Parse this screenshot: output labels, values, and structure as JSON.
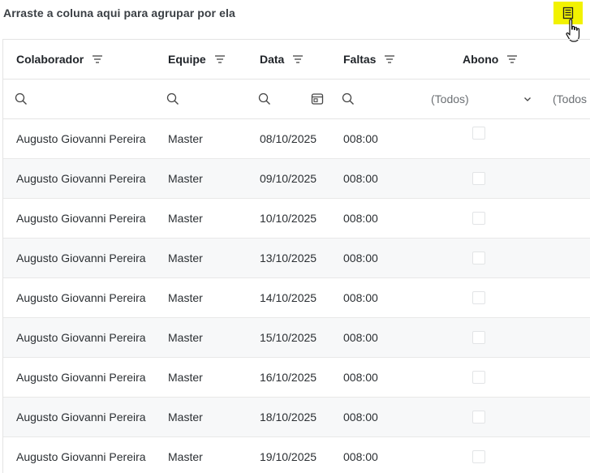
{
  "group_panel": {
    "hint": "Arraste a coluna aqui para agrupar por ela",
    "column_chooser_icon": "column-chooser-icon",
    "highlight_color": "#f2f200"
  },
  "columns": [
    {
      "label": "Colaborador",
      "icon": "filter-lines-icon"
    },
    {
      "label": "Equipe",
      "icon": "filter-lines-icon"
    },
    {
      "label": "Data",
      "icon": "filter-lines-icon"
    },
    {
      "label": "Faltas",
      "icon": "filter-lines-icon"
    },
    {
      "label": "Abono",
      "icon": "filter-lines-icon"
    }
  ],
  "filters": {
    "abono_select": "(Todos)",
    "next_select": "(Todos"
  },
  "rows": [
    {
      "colaborador": "Augusto Giovanni Pereira",
      "equipe": "Master",
      "data": "08/10/2025",
      "faltas": "008:00"
    },
    {
      "colaborador": "Augusto Giovanni Pereira",
      "equipe": "Master",
      "data": "09/10/2025",
      "faltas": "008:00"
    },
    {
      "colaborador": "Augusto Giovanni Pereira",
      "equipe": "Master",
      "data": "10/10/2025",
      "faltas": "008:00"
    },
    {
      "colaborador": "Augusto Giovanni Pereira",
      "equipe": "Master",
      "data": "13/10/2025",
      "faltas": "008:00"
    },
    {
      "colaborador": "Augusto Giovanni Pereira",
      "equipe": "Master",
      "data": "14/10/2025",
      "faltas": "008:00"
    },
    {
      "colaborador": "Augusto Giovanni Pereira",
      "equipe": "Master",
      "data": "15/10/2025",
      "faltas": "008:00"
    },
    {
      "colaborador": "Augusto Giovanni Pereira",
      "equipe": "Master",
      "data": "16/10/2025",
      "faltas": "008:00"
    },
    {
      "colaborador": "Augusto Giovanni Pereira",
      "equipe": "Master",
      "data": "18/10/2025",
      "faltas": "008:00"
    },
    {
      "colaborador": "Augusto Giovanni Pereira",
      "equipe": "Master",
      "data": "19/10/2025",
      "faltas": "008:00"
    }
  ]
}
